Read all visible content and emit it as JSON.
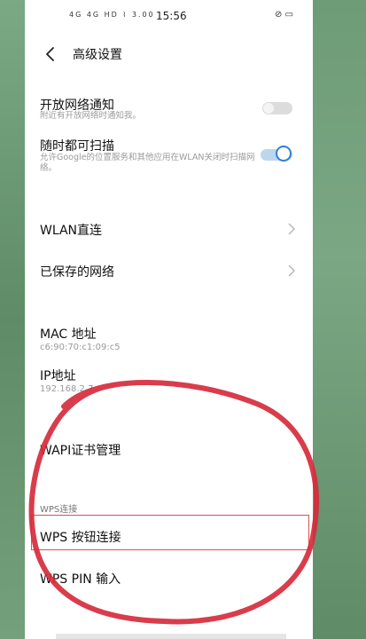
{
  "status_bar": {
    "left_icons": "4G 4G HD ⌇ 3.00",
    "time": "15:56",
    "right_icons": "⊘ ▭"
  },
  "header": {
    "title": "高级设置"
  },
  "settings": {
    "open_network_notify": {
      "label": "开放网络通知",
      "description": "附近有开放网络时通知我。",
      "enabled": false
    },
    "always_scan": {
      "label": "随时都可扫描",
      "description": "允许Google的位置服务和其他应用在WLAN关闭时扫描网络。",
      "enabled": true
    },
    "wlan_direct": {
      "label": "WLAN直连"
    },
    "saved_networks": {
      "label": "已保存的网络"
    },
    "mac": {
      "label": "MAC 地址",
      "value": "c6:90:70:c1:09:c5"
    },
    "ip": {
      "label": "IP地址",
      "value": "192.168.2.7"
    },
    "wapi": {
      "label": "WAPI证书管理"
    },
    "wps_section": {
      "title": "WPS连接"
    },
    "wps_button": {
      "label": "WPS 按钮连接"
    },
    "wps_pin": {
      "label": "WPS PIN 输入"
    }
  },
  "colors": {
    "toggle_on": "#2f7fd6",
    "annotation": "#d62b3c",
    "highlight_box": "#d9534f"
  }
}
